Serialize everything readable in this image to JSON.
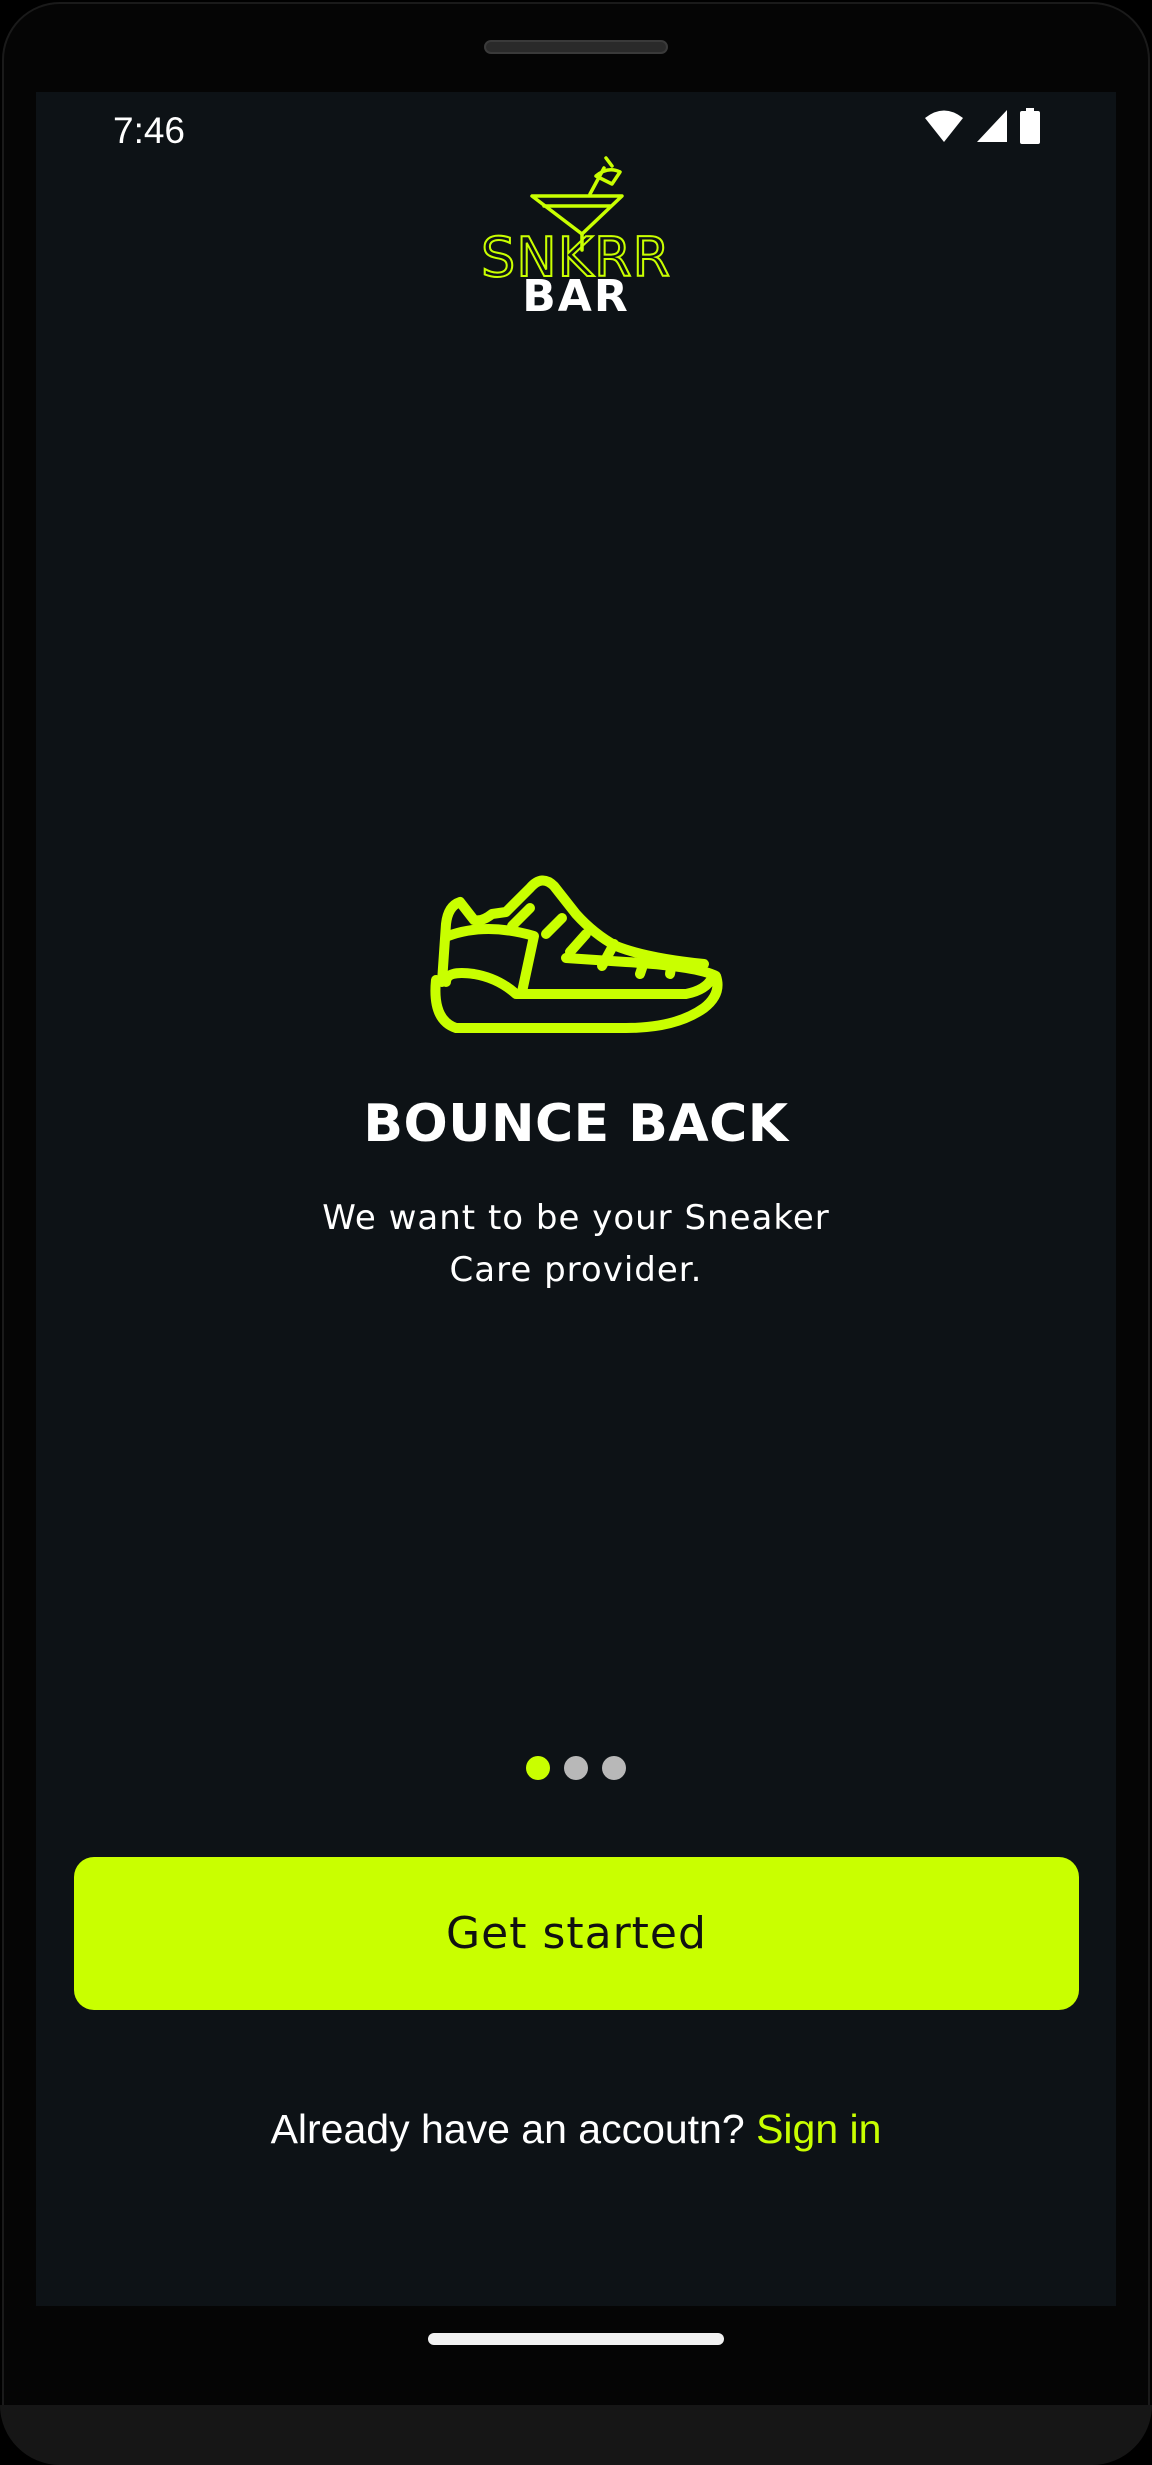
{
  "status_bar": {
    "time": "7:46",
    "icons": [
      "wifi-icon",
      "cellular-signal-icon",
      "battery-icon"
    ]
  },
  "logo": {
    "line1": "SNKRR",
    "line2": "BAR",
    "icon": "cocktail-glass-icon"
  },
  "onboarding": {
    "icon": "sneaker-icon",
    "title": "BOUNCE BACK",
    "description": "We want to be your Sneaker Care provider.",
    "page_count": 3,
    "current_page": 1
  },
  "actions": {
    "get_started_label": "Get started",
    "signin_prompt": "Already have an accoutn?",
    "signin_link": "Sign in"
  },
  "colors": {
    "accent": "#c9ff00",
    "background": "#0d1216",
    "text": "#ffffff",
    "inactive_dot": "#b8b8b8"
  }
}
